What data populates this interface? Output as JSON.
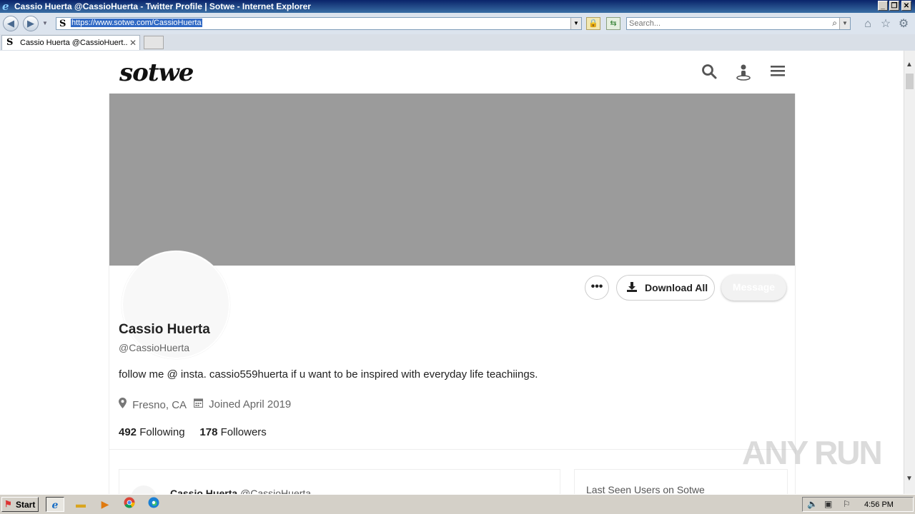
{
  "window": {
    "title": "Cassio Huerta @CassioHuerta - Twitter Profile | Sotwe - Internet Explorer",
    "minimize_glyph": "_",
    "restore_glyph": "❐",
    "close_glyph": "✕"
  },
  "addressbar": {
    "url": "https://www.sotwe.com/CassioHuerta",
    "favicon": "S",
    "search_placeholder": "Search..."
  },
  "tabs": [
    {
      "label": "Cassio Huerta @CassioHuert...",
      "favicon": "S"
    }
  ],
  "site": {
    "logo": "sotwe"
  },
  "profile": {
    "name": "Cassio Huerta",
    "handle": "@CassioHuerta",
    "bio": "follow me @ insta. cassio559huerta if u want to be inspired with everyday life teachiings.",
    "location": "Fresno, CA",
    "joined": "Joined April 2019",
    "following_count": "492",
    "following_label": "Following",
    "followers_count": "178",
    "followers_label": "Followers",
    "banner_color": "#9b9b9b"
  },
  "actions": {
    "more": "•••",
    "download_all": "Download All",
    "message": "Message"
  },
  "tweet_preview": {
    "author_name": "Cassio Huerta",
    "author_handle": "@CassioHuerta"
  },
  "sidebar": {
    "title": "Last Seen Users on Sotwe"
  },
  "watermark": "ANY RUN",
  "taskbar": {
    "start_label": "Start",
    "clock": "4:56 PM",
    "apps": [
      "internet-explorer",
      "file-explorer",
      "media-player",
      "chrome",
      "edge"
    ]
  }
}
